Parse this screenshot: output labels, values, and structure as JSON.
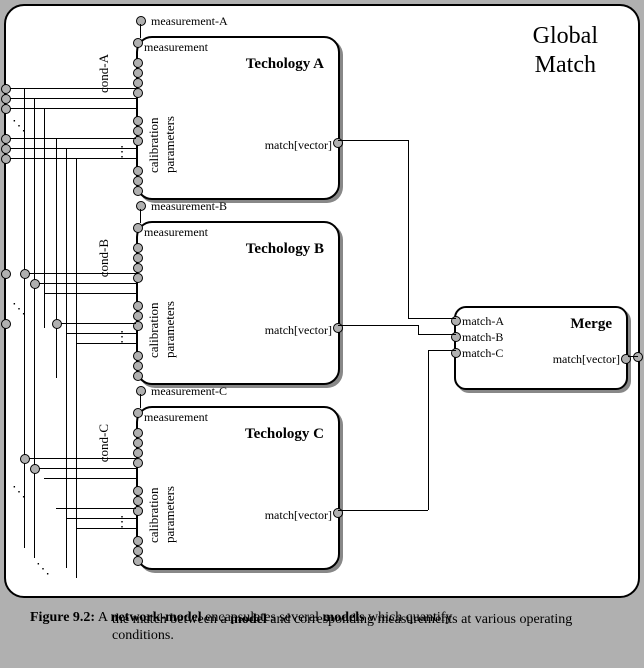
{
  "global_title_line1": "Global",
  "global_title_line2": "Match",
  "tech_boxes": [
    {
      "title": "Techology A",
      "measurement_label": "measurement",
      "match_label": "match[vector]",
      "calib_label": "calibration\nparameters",
      "cond_label": "cond-A",
      "ext_measurement": "measurement-A"
    },
    {
      "title": "Techology B",
      "measurement_label": "measurement",
      "match_label": "match[vector]",
      "calib_label": "calibration\nparameters",
      "cond_label": "cond-B",
      "ext_measurement": "measurement-B"
    },
    {
      "title": "Techology C",
      "measurement_label": "measurement",
      "match_label": "match[vector]",
      "calib_label": "calibration\nparameters",
      "cond_label": "cond-C",
      "ext_measurement": "measurement-C"
    }
  ],
  "merge": {
    "title": "Merge",
    "inputs": [
      "match-A",
      "match-B",
      "match-C"
    ],
    "output": "match[vector]"
  },
  "caption": {
    "label": "Figure 9.2:",
    "text": "A network-model encapsulates several models which quantify the match between a model and corresponding measurements at various operating conditions.",
    "bold1": "network-model",
    "bold2": "models",
    "bold3": "model"
  }
}
